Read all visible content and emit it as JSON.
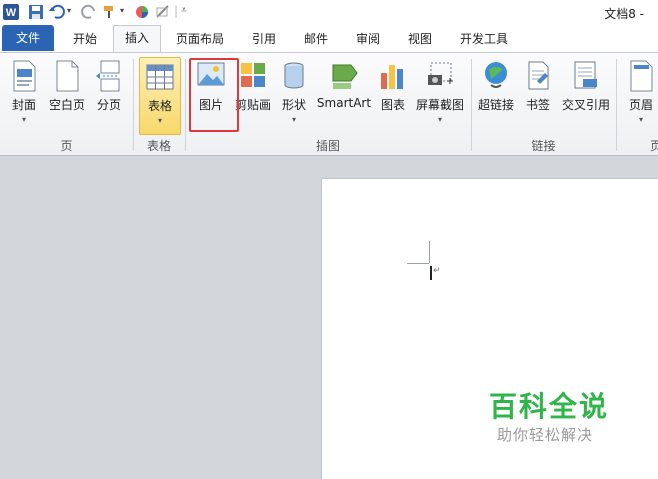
{
  "title_bar": {
    "document_title": "文档8 -"
  },
  "tabs": [
    {
      "label": "文件"
    },
    {
      "label": "开始"
    },
    {
      "label": "插入"
    },
    {
      "label": "页面布局"
    },
    {
      "label": "引用"
    },
    {
      "label": "邮件"
    },
    {
      "label": "审阅"
    },
    {
      "label": "视图"
    },
    {
      "label": "开发工具"
    }
  ],
  "ribbon": {
    "buttons": [
      {
        "label": "封面",
        "icon": "cover-page-icon"
      },
      {
        "label": "空白页",
        "icon": "blank-page-icon"
      },
      {
        "label": "分页",
        "icon": "page-break-icon"
      },
      {
        "label": "表格",
        "icon": "table-icon"
      },
      {
        "label": "图片",
        "icon": "picture-icon"
      },
      {
        "label": "剪贴画",
        "icon": "clip-art-icon"
      },
      {
        "label": "形状",
        "icon": "shapes-icon"
      },
      {
        "label": "SmartArt",
        "icon": "smartart-icon"
      },
      {
        "label": "图表",
        "icon": "chart-icon"
      },
      {
        "label": "屏幕截图",
        "icon": "screenshot-icon"
      },
      {
        "label": "超链接",
        "icon": "hyperlink-icon"
      },
      {
        "label": "书签",
        "icon": "bookmark-icon"
      },
      {
        "label": "交叉引用",
        "icon": "cross-reference-icon"
      },
      {
        "label": "页眉",
        "icon": "header-icon"
      }
    ],
    "groups": [
      {
        "label": "页"
      },
      {
        "label": "表格"
      },
      {
        "label": "插图"
      },
      {
        "label": "链接"
      },
      {
        "label": "页"
      }
    ]
  },
  "watermark": {
    "title": "百科全说",
    "subtitle": "助你轻松解决"
  },
  "colors": {
    "file_tab": "#2b64b3",
    "highlight": "#e0393b",
    "watermark": "#2fb54a"
  }
}
